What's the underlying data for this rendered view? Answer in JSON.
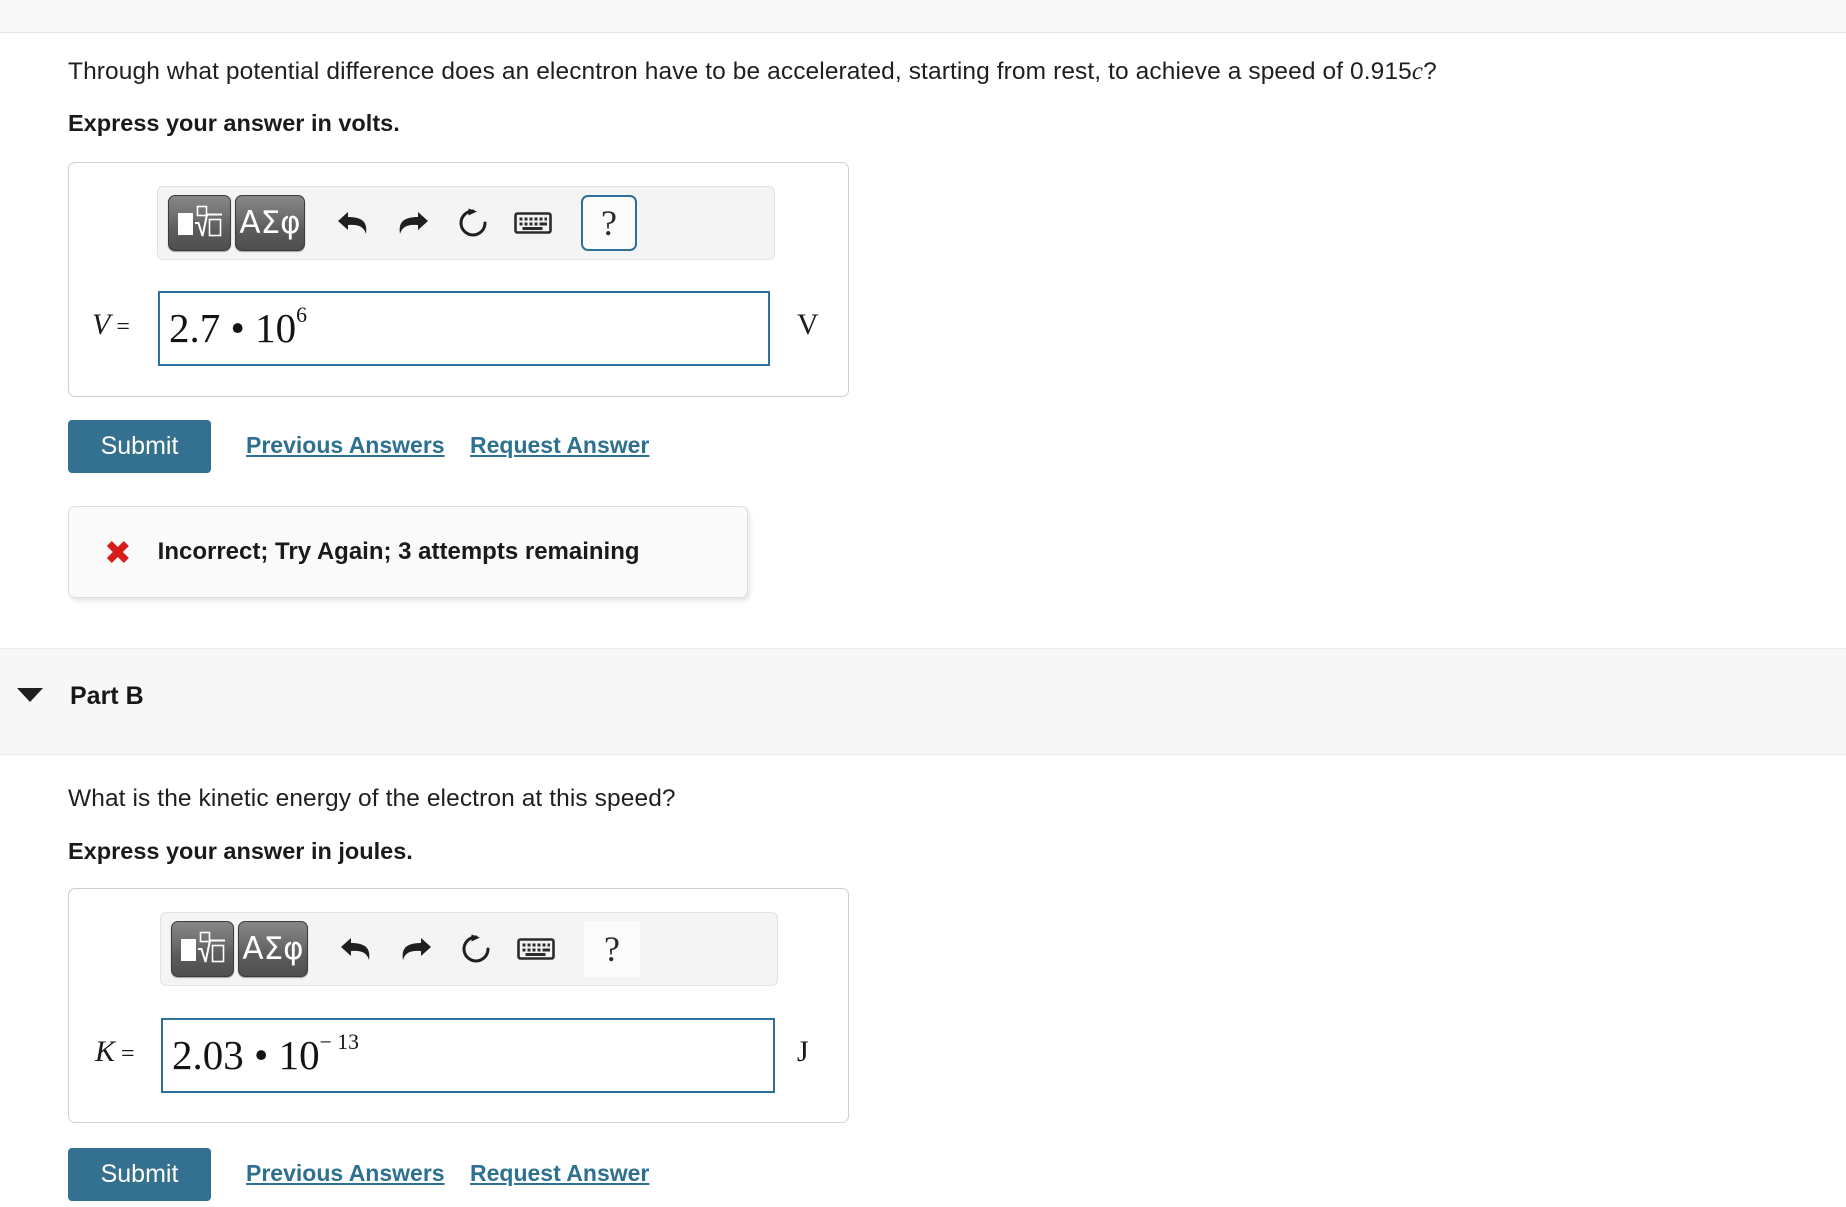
{
  "parts": [
    {
      "id": "part-a",
      "question": "Through what potential difference does an elecntron have to be accelerated, starting from rest, to achieve a speed of 0.915",
      "question_italic": "c",
      "question_tail": "?",
      "express": "Express your answer in volts.",
      "toolbar": {
        "math_template_label": "math-template",
        "greek_label": "ΑΣφ",
        "undo_label": "undo",
        "redo_label": "redo",
        "reset_label": "reset",
        "keyboard_label": "keyboard",
        "help_label": "?"
      },
      "variable": "V",
      "equals": " =",
      "value_mantissa": "2.7 • 10",
      "value_exponent": "6",
      "unit": "V",
      "submit_label": "Submit",
      "previous_answers_label": "Previous Answers",
      "request_answer_label": "Request Answer",
      "feedback": {
        "icon": "✖",
        "message": "Incorrect; Try Again; 3 attempts remaining"
      }
    },
    {
      "id": "part-b",
      "band_title": "Part B",
      "question": "What is the kinetic energy of the electron at this speed?",
      "express": "Express your answer in joules.",
      "toolbar": {
        "math_template_label": "math-template",
        "greek_label": "ΑΣφ",
        "undo_label": "undo",
        "redo_label": "redo",
        "reset_label": "reset",
        "keyboard_label": "keyboard",
        "help_label": "?"
      },
      "variable": "K",
      "equals": " =",
      "value_mantissa": "2.03 • 10",
      "value_exponent": "− 13",
      "unit": "J",
      "submit_label": "Submit",
      "previous_answers_label": "Previous Answers",
      "request_answer_label": "Request Answer"
    }
  ],
  "colors": {
    "accent": "#34708f",
    "link": "#2d7090",
    "input_border": "#2e7099",
    "error": "#d81c1c",
    "band": "#f7f7f7"
  }
}
